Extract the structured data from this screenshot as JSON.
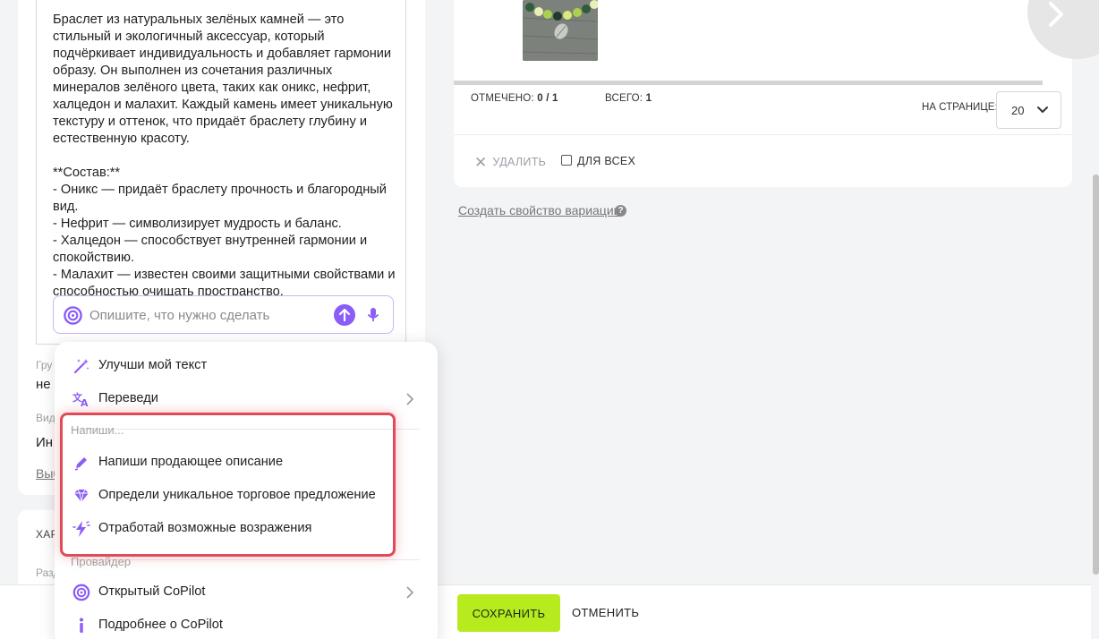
{
  "editor": {
    "text": "Браслет из натуральных зелёных камней — это стильный и экологичный аксессуар, который подчёркивает индивидуальность и добавляет гармонии образу. Он выполнен из сочетания различных минералов зелёного цвета, таких как оникс, нефрит, халцедон и малахит. Каждый камень имеет уникальную текстуру и оттенок, что придаёт браслету глубину и естественную красоту.\n\n**Состав:**\n- Оникс — придаёт браслету прочность и благородный вид.\n- Нефрит — символизирует мудрость и баланс.\n- Халцедон — способствует внутренней гармонии и спокойствию.\n- Малахит — известен своими защитными свойствами и способностью очищать пространство."
  },
  "ai_input": {
    "placeholder": "Опишите, что нужно сделать",
    "value": ""
  },
  "left_fields": {
    "label1": "Гру",
    "value1": "не",
    "label2": "Вид",
    "value2": "Ин",
    "link": "Выб",
    "section_head": "ХАР",
    "section_sub": "Разд"
  },
  "menu": {
    "items_top": [
      {
        "label": "Улучши мой текст",
        "icon": "magic-wand-icon"
      },
      {
        "label": "Переведи",
        "icon": "translate-icon",
        "has_submenu": true
      }
    ],
    "section_write": "Напиши...",
    "items_write": [
      {
        "label": "Напиши продающее описание",
        "icon": "pen-icon"
      },
      {
        "label": "Определи уникальное торговое предложение",
        "icon": "diamond-icon"
      },
      {
        "label": "Отработай возможные возражения",
        "icon": "lightning-icon"
      }
    ],
    "section_provider": "Провайдер",
    "items_provider": [
      {
        "label": "Открытый CoPilot",
        "icon": "copilot-icon",
        "has_submenu": true
      },
      {
        "label": "Подробнее о CoPilot",
        "icon": "info-icon"
      }
    ]
  },
  "variations": {
    "selected_label": "ОТМЕЧЕНО:",
    "selected_value": "0 / 1",
    "total_label": "ВСЕГО:",
    "total_value": "1",
    "per_page_label": "НА СТРАНИЦЕ:",
    "per_page_value": "20",
    "delete_label": "УДАЛИТЬ",
    "for_all_label": "ДЛЯ ВСЕХ",
    "create_variation_link": "Создать свойство вариации",
    "help": "?"
  },
  "footer": {
    "save_label": "СОХРАНИТЬ",
    "cancel_label": "ОТМЕНИТЬ"
  },
  "colors": {
    "accent_purple": "#8b5cf6",
    "save_green": "#b7eb1e",
    "highlight_red": "#e14b57"
  }
}
